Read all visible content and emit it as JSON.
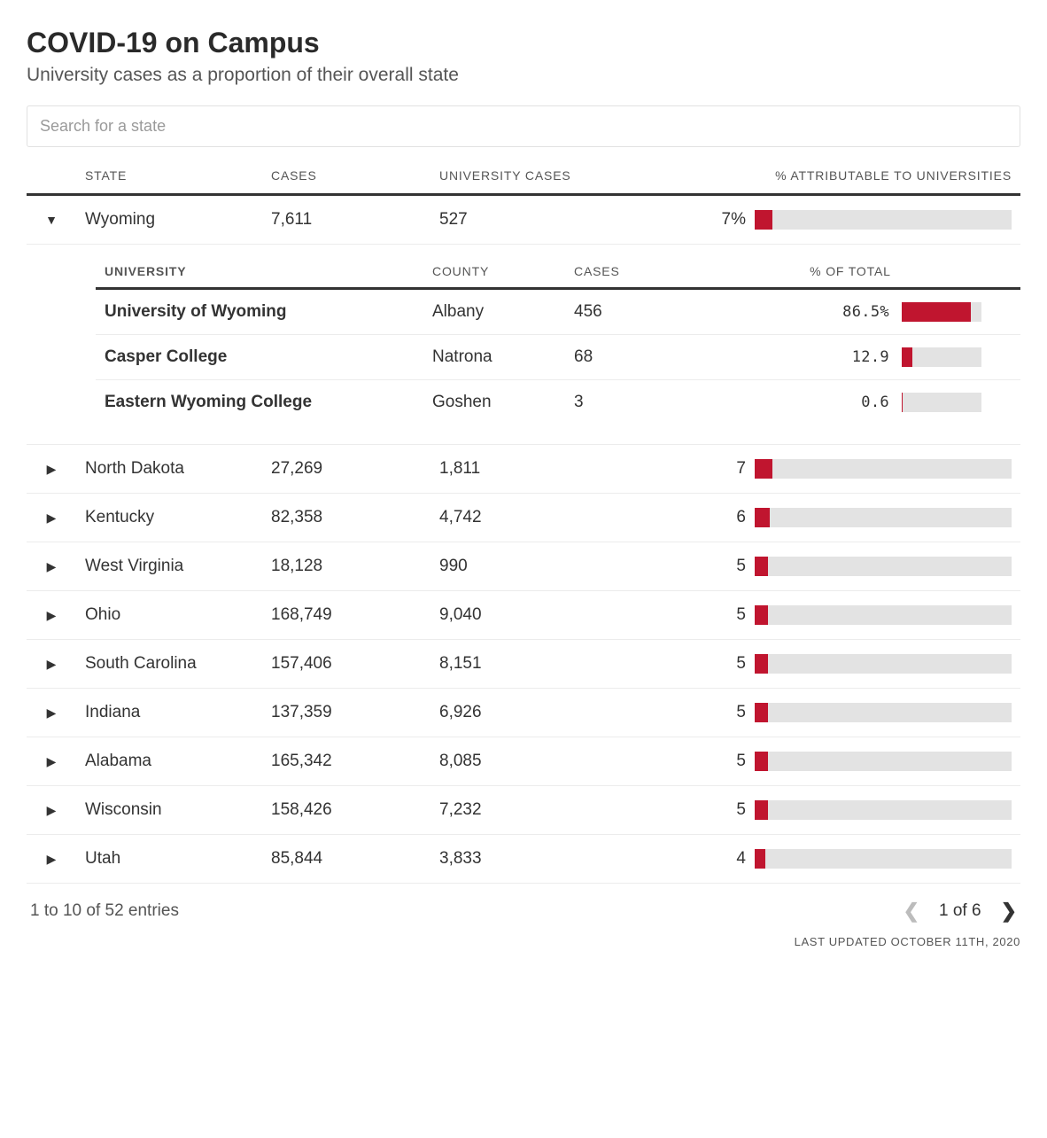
{
  "header": {
    "title": "COVID-19 on Campus",
    "subtitle": "University cases as a proportion of their overall state"
  },
  "search": {
    "placeholder": "Search for a state"
  },
  "columns": {
    "state": "STATE",
    "cases": "CASES",
    "university_cases": "UNIVERSITY CASES",
    "pct": "% ATTRIBUTABLE TO UNIVERSITIES"
  },
  "detail_columns": {
    "university": "UNIVERSITY",
    "county": "COUNTY",
    "cases": "CASES",
    "pct": "% OF TOTAL"
  },
  "rows": [
    {
      "state": "Wyoming",
      "cases": "7,611",
      "university_cases": "527",
      "pct_label": "7%",
      "pct_value": 7,
      "expanded": true,
      "details": [
        {
          "university": "University of Wyoming",
          "county": "Albany",
          "cases": "456",
          "pct_label": "86.5%",
          "pct_value": 86.5
        },
        {
          "university": "Casper College",
          "county": "Natrona",
          "cases": "68",
          "pct_label": "12.9",
          "pct_value": 12.9
        },
        {
          "university": "Eastern Wyoming College",
          "county": "Goshen",
          "cases": "3",
          "pct_label": "0.6",
          "pct_value": 0.6
        }
      ]
    },
    {
      "state": "North Dakota",
      "cases": "27,269",
      "university_cases": "1,811",
      "pct_label": "7",
      "pct_value": 7
    },
    {
      "state": "Kentucky",
      "cases": "82,358",
      "university_cases": "4,742",
      "pct_label": "6",
      "pct_value": 6
    },
    {
      "state": "West Virginia",
      "cases": "18,128",
      "university_cases": "990",
      "pct_label": "5",
      "pct_value": 5
    },
    {
      "state": "Ohio",
      "cases": "168,749",
      "university_cases": "9,040",
      "pct_label": "5",
      "pct_value": 5
    },
    {
      "state": "South Carolina",
      "cases": "157,406",
      "university_cases": "8,151",
      "pct_label": "5",
      "pct_value": 5
    },
    {
      "state": "Indiana",
      "cases": "137,359",
      "university_cases": "6,926",
      "pct_label": "5",
      "pct_value": 5
    },
    {
      "state": "Alabama",
      "cases": "165,342",
      "university_cases": "8,085",
      "pct_label": "5",
      "pct_value": 5
    },
    {
      "state": "Wisconsin",
      "cases": "158,426",
      "university_cases": "7,232",
      "pct_label": "5",
      "pct_value": 5
    },
    {
      "state": "Utah",
      "cases": "85,844",
      "university_cases": "3,833",
      "pct_label": "4",
      "pct_value": 4
    }
  ],
  "footer": {
    "summary": "1 to 10 of 52 entries",
    "page": "1 of 6",
    "updated": "LAST UPDATED OCTOBER 11TH, 2020"
  },
  "chart_scale": {
    "main_max": 100,
    "detail_max": 100
  },
  "chart_data": {
    "type": "bar",
    "title": "COVID-19 on Campus",
    "subtitle": "University cases as a proportion of their overall state",
    "xlabel": "% ATTRIBUTABLE TO UNIVERSITIES",
    "ylim": [
      0,
      100
    ],
    "categories": [
      "Wyoming",
      "North Dakota",
      "Kentucky",
      "West Virginia",
      "Ohio",
      "South Carolina",
      "Indiana",
      "Alabama",
      "Wisconsin",
      "Utah"
    ],
    "series": [
      {
        "name": "% attributable to universities",
        "values": [
          7,
          7,
          6,
          5,
          5,
          5,
          5,
          5,
          5,
          4
        ]
      }
    ],
    "detail": {
      "state": "Wyoming",
      "metric": "% of total university cases",
      "categories": [
        "University of Wyoming",
        "Casper College",
        "Eastern Wyoming College"
      ],
      "values": [
        86.5,
        12.9,
        0.6
      ]
    }
  }
}
